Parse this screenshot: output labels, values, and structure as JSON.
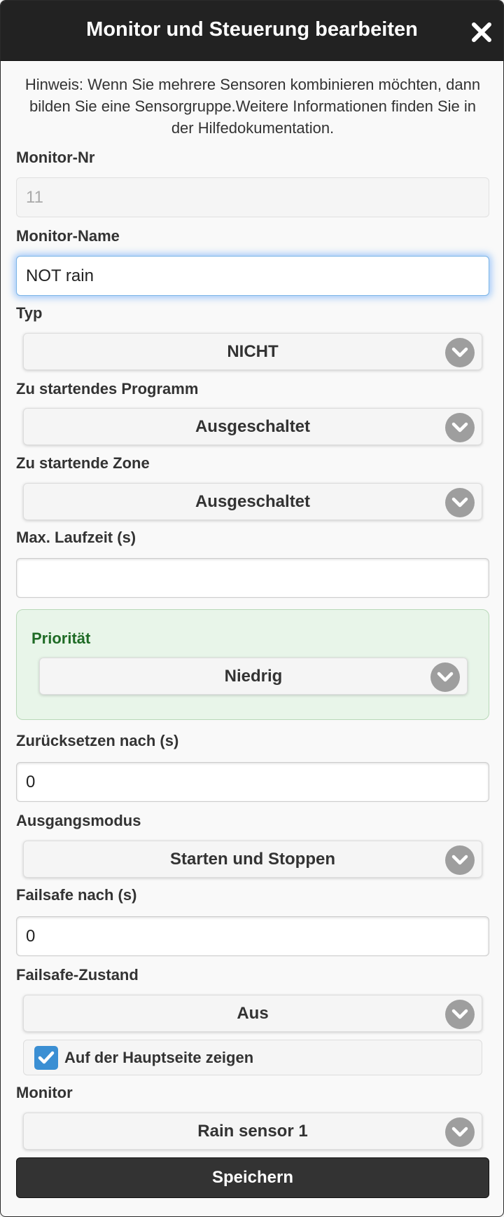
{
  "dialog": {
    "title": "Monitor und Steuerung bearbeiten",
    "close_icon": "close-icon",
    "notice": "Hinweis: Wenn Sie mehrere Sensoren kombinieren möchten, dann bilden Sie eine Sensorgruppe.Weitere Informationen finden Sie in der Hilfedokumentation."
  },
  "fields": {
    "monitor_nr": {
      "label": "Monitor-Nr",
      "value": "11"
    },
    "monitor_name": {
      "label": "Monitor-Name",
      "value": "NOT rain"
    },
    "typ": {
      "label": "Typ",
      "value": "NICHT"
    },
    "programm": {
      "label": "Zu startendes Programm",
      "value": "Ausgeschaltet"
    },
    "zone": {
      "label": "Zu startende Zone",
      "value": "Ausgeschaltet"
    },
    "max_laufzeit": {
      "label": "Max. Laufzeit (s)",
      "value": ""
    },
    "prioritaet": {
      "label": "Priorität",
      "value": "Niedrig"
    },
    "zuruecksetzen": {
      "label": "Zurücksetzen nach (s)",
      "value": "0"
    },
    "ausgangsmodus": {
      "label": "Ausgangsmodus",
      "value": "Starten und Stoppen"
    },
    "failsafe": {
      "label": "Failsafe nach (s)",
      "value": "0"
    },
    "failsafe_zustand": {
      "label": "Failsafe-Zustand",
      "value": "Aus"
    },
    "hauptseite": {
      "label": "Auf der Hauptseite zeigen",
      "checked": true
    },
    "monitor": {
      "label": "Monitor",
      "value": "Rain sensor 1"
    }
  },
  "actions": {
    "save_label": "Speichern"
  },
  "colors": {
    "header": "#222222",
    "accent": "#3b8fd3",
    "priority_bg": "#e8f5e9",
    "priority_text": "#1f6b26"
  }
}
